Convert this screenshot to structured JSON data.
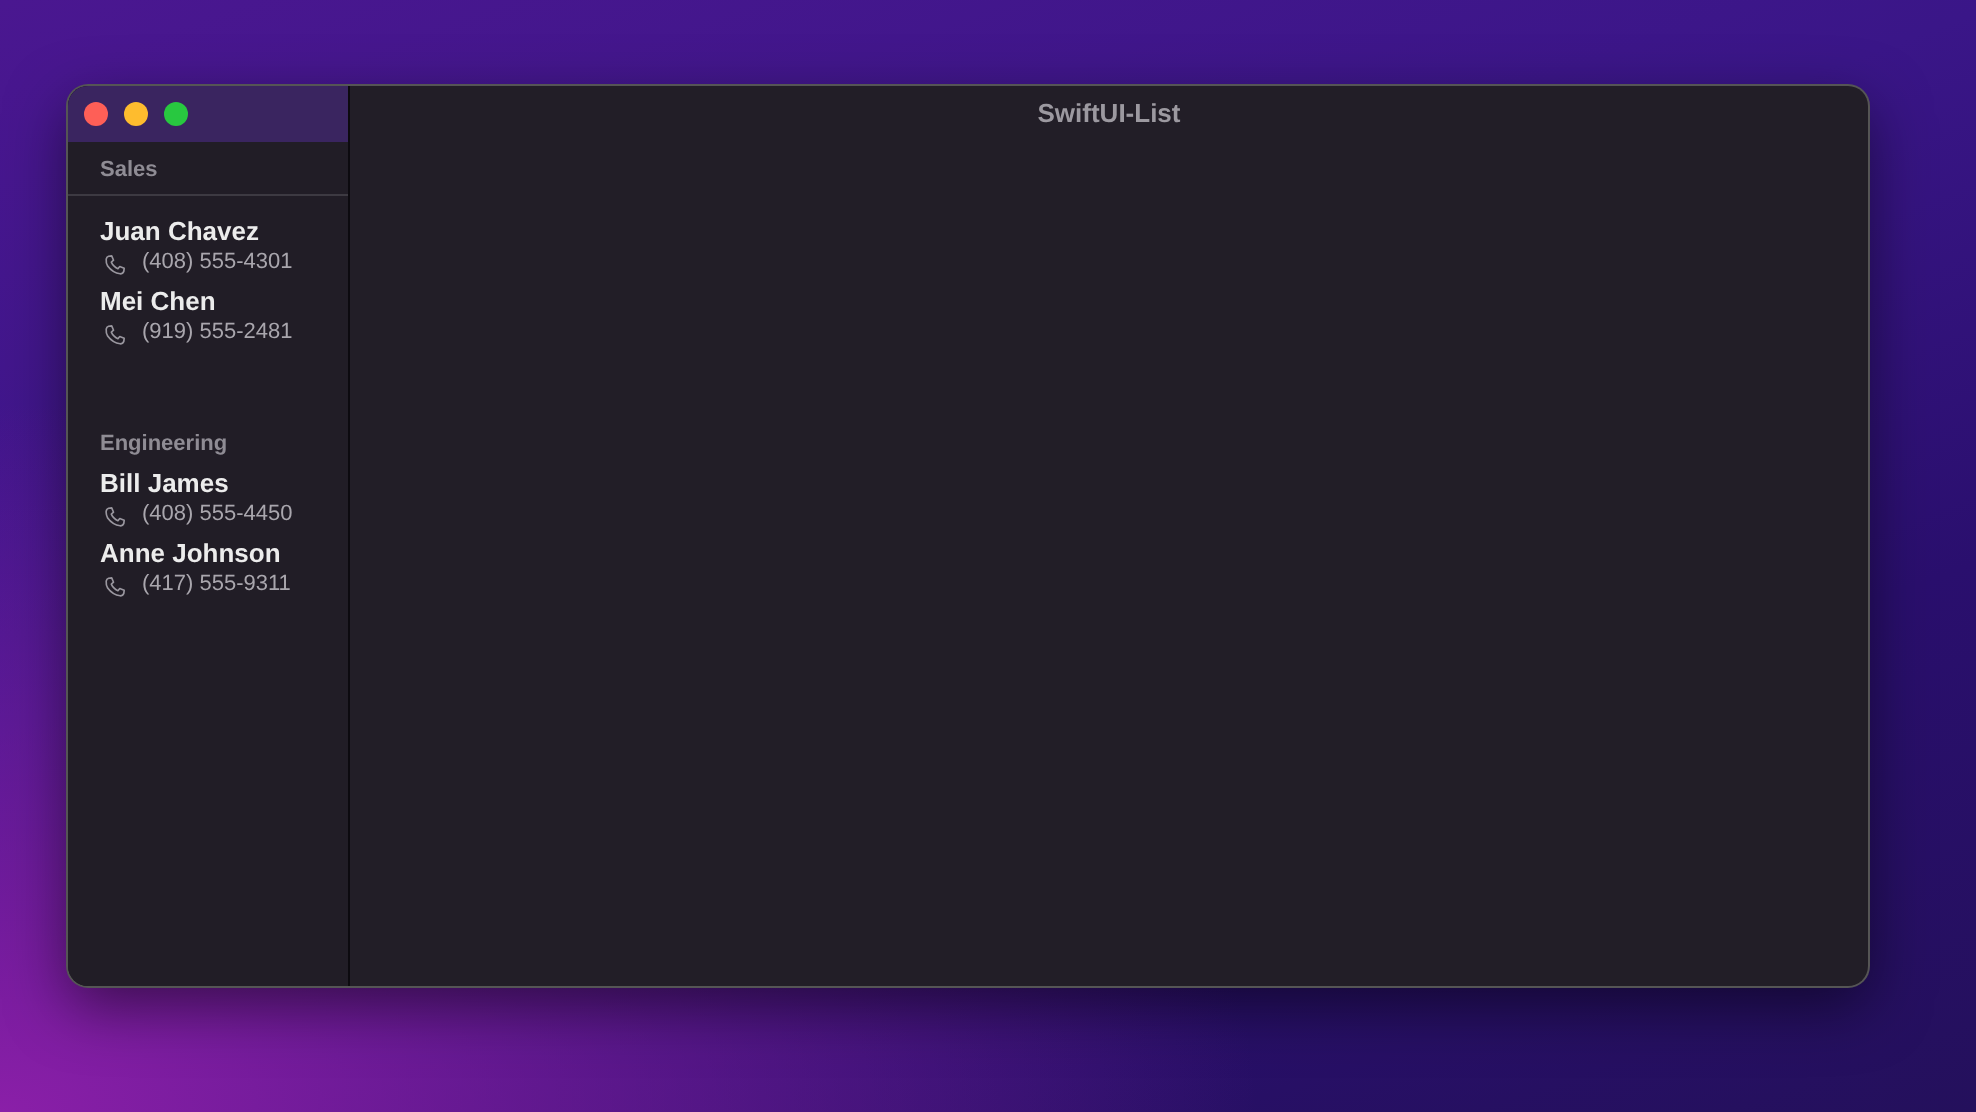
{
  "window": {
    "title": "SwiftUI-List"
  },
  "sections": [
    {
      "header": "Sales",
      "people": [
        {
          "name": "Juan Chavez",
          "phone": "(408) 555-4301"
        },
        {
          "name": "Mei Chen",
          "phone": "(919) 555-2481"
        }
      ]
    },
    {
      "header": "Engineering",
      "people": [
        {
          "name": "Bill James",
          "phone": "(408) 555-4450"
        },
        {
          "name": "Anne Johnson",
          "phone": "(417) 555-9311"
        }
      ]
    }
  ]
}
